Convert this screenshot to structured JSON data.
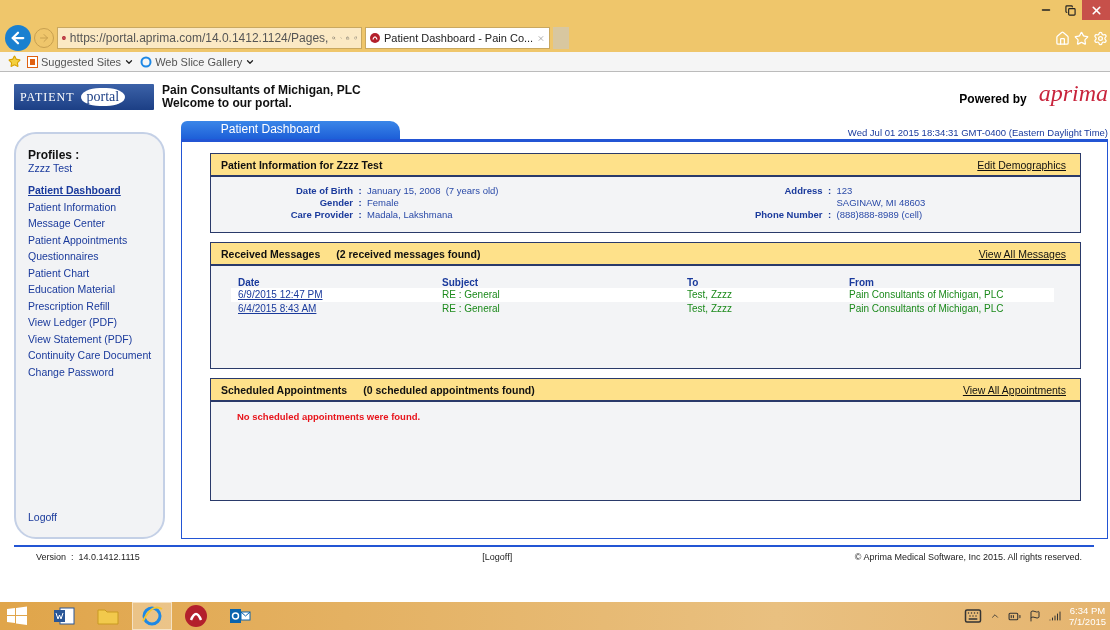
{
  "browser": {
    "address": "https://portal.aprima.com/14.0.1412.1124/Pages,",
    "tab": {
      "title": "Patient Dashboard - Pain Co...",
      "selected": true
    },
    "favorites": [
      "Suggested Sites",
      "Web Slice Gallery"
    ]
  },
  "header": {
    "logo_words": [
      "PATIENT",
      "portal"
    ],
    "org": "Pain Consultants of Michigan, PLC",
    "welcome": "Welcome to our portal.",
    "powered_by": "Powered by",
    "brand": "aprima"
  },
  "sidebar": {
    "profiles_label": "Profiles :",
    "profile": "Zzzz Test",
    "items": [
      {
        "label": "Patient Dashboard",
        "selected": true
      },
      {
        "label": "Patient Information",
        "selected": false
      },
      {
        "label": "Message Center",
        "selected": false
      },
      {
        "label": "Patient Appointments",
        "selected": false
      },
      {
        "label": "Questionnaires",
        "selected": false
      },
      {
        "label": "Patient Chart",
        "selected": false
      },
      {
        "label": "Education Material",
        "selected": false
      },
      {
        "label": "Prescription Refill",
        "selected": false
      },
      {
        "label": "View Ledger (PDF)",
        "selected": false
      },
      {
        "label": "View Statement (PDF)",
        "selected": false
      },
      {
        "label": "Continuity Care Document",
        "selected": false
      },
      {
        "label": "Change Password",
        "selected": false
      }
    ],
    "logoff": "Logoff"
  },
  "main": {
    "tab": {
      "label": "Patient Dashboard",
      "selected": true
    },
    "timestamp": "Wed Jul 01 2015 18:34:31 GMT-0400 (Eastern Daylight Time)"
  },
  "patient_info": {
    "title": "Patient Information for Zzzz Test",
    "link": "Edit Demographics",
    "separator": ":",
    "left": [
      {
        "label": "Date of Birth",
        "values": [
          "January 15, 2008  (7 years old)"
        ]
      },
      {
        "label": "Gender",
        "values": [
          "Female"
        ]
      },
      {
        "label": "Care Provider",
        "values": [
          "Madala, Lakshmana"
        ]
      }
    ],
    "right": [
      {
        "label": "Address",
        "values": [
          "123",
          "SAGINAW, MI 48603"
        ]
      },
      {
        "label": "Phone Number",
        "values": [
          "(888)888-8989 (cell)"
        ]
      }
    ]
  },
  "messages": {
    "title": "Received Messages",
    "count": "(2 received messages found)",
    "link": "View All Messages",
    "columns": [
      "Date",
      "Subject",
      "To",
      "From"
    ],
    "rows": [
      {
        "date": "6/9/2015 12:47 PM",
        "subject": "RE : General",
        "to": "Test, Zzzz",
        "from": "Pain Consultants of Michigan, PLC",
        "selected": true
      },
      {
        "date": "6/4/2015 8:43 AM",
        "subject": "RE : General",
        "to": "Test, Zzzz",
        "from": "Pain Consultants of Michigan, PLC",
        "selected": false
      }
    ]
  },
  "appointments": {
    "title": "Scheduled Appointments",
    "count": "(0 scheduled appointments found)",
    "link": "View All Appointments",
    "empty": "No scheduled appointments were found."
  },
  "footer": {
    "version": "Version  :  14.0.1412.1115",
    "logoff": "[Logoff]",
    "copyright": "© Aprima Medical Software, Inc 2015. All rights reserved."
  },
  "taskbar": {
    "apps": [
      {
        "kind": "word",
        "selected": false
      },
      {
        "kind": "folder",
        "selected": false
      },
      {
        "kind": "ie",
        "selected": true
      },
      {
        "kind": "aprima",
        "selected": false
      },
      {
        "kind": "outlook",
        "selected": false
      }
    ],
    "time": "6:34 PM",
    "date": "7/1/2015"
  }
}
